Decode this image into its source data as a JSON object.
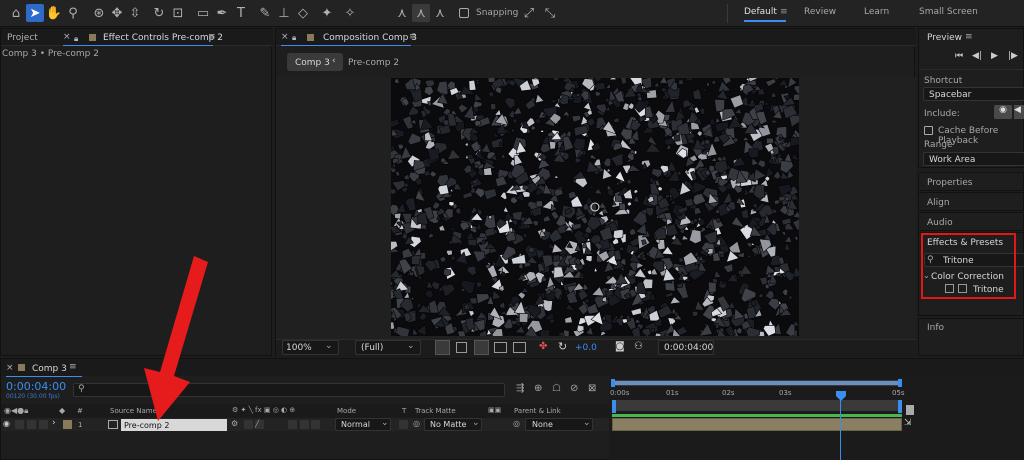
{
  "toolbar": {
    "snapping_label": "Snapping",
    "workspaces": [
      "Default",
      "Review",
      "Learn",
      "Small Screen"
    ]
  },
  "left_panel": {
    "tab_project": "Project",
    "tab_effect_controls": "Effect Controls Pre-comp 2",
    "breadcrumb": "Comp 3 • Pre-comp 2"
  },
  "composition": {
    "tab_title": "Composition Comp 3",
    "flow_current": "Comp 3",
    "flow_child": "Pre-comp 2",
    "zoom": "100%",
    "resolution": "(Full)",
    "exposure": "+0.0",
    "timecode": "0:00:04:00"
  },
  "right_panel": {
    "preview_title": "Preview",
    "shortcut_label": "Shortcut",
    "shortcut_value": "Spacebar",
    "include_label": "Include:",
    "cache_label": "Cache Before Playback",
    "range_label": "Range",
    "range_value": "Work Area",
    "properties": "Properties",
    "align": "Align",
    "audio": "Audio",
    "effects_title": "Effects & Presets",
    "search_value": "Tritone",
    "category": "Color Correction",
    "effect_item": "Tritone",
    "info": "Info"
  },
  "timeline": {
    "tab_title": "Comp 3",
    "timecode": "0:00:04:00",
    "fps_info": "00120 (30.00 fps)",
    "col_num": "#",
    "col_source": "Source Name",
    "col_mode": "Mode",
    "col_t": "T",
    "col_track_matte": "Track Matte",
    "col_parent": "Parent & Link",
    "ruler_labels": [
      "0:00s",
      "01s",
      "02s",
      "03s",
      "05s"
    ],
    "layer": {
      "number": "1",
      "name": "Pre-comp 2",
      "mode": "Normal",
      "track_matte": "No Matte",
      "parent": "None"
    }
  },
  "colors": {
    "accent": "#2e6ac8",
    "highlight_box": "#e01818",
    "arrow": "#e61b1b",
    "layer_bar": "#8a7e63"
  }
}
